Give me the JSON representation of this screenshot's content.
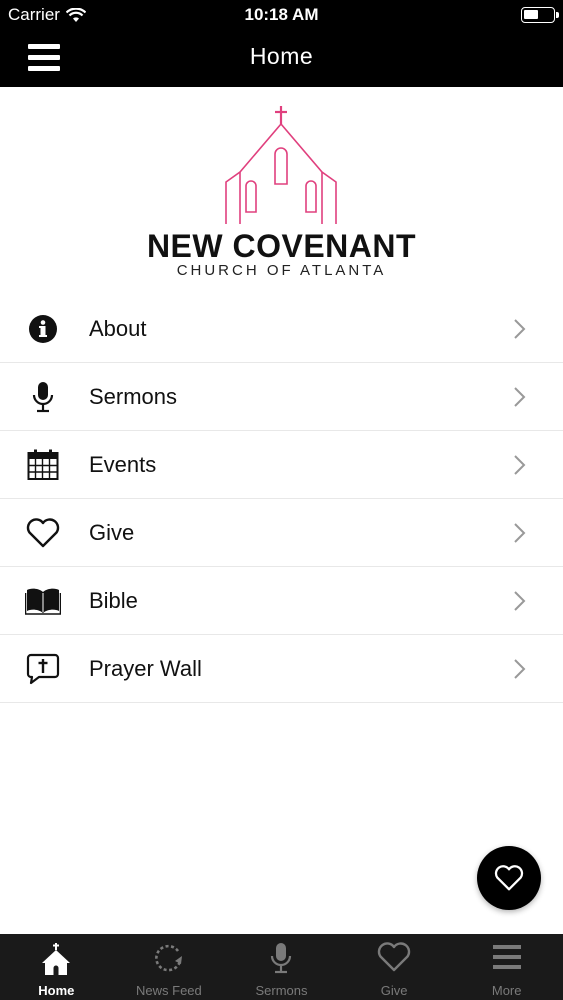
{
  "status_bar": {
    "carrier": "Carrier",
    "time": "10:18 AM"
  },
  "nav": {
    "title": "Home"
  },
  "logo": {
    "name": "NEW COVENANT",
    "subtitle": "CHURCH OF ATLANTA",
    "accent_color": "#e0407e"
  },
  "menu": {
    "items": [
      {
        "label": "About",
        "icon": "info-icon"
      },
      {
        "label": "Sermons",
        "icon": "microphone-icon"
      },
      {
        "label": "Events",
        "icon": "calendar-icon"
      },
      {
        "label": "Give",
        "icon": "heart-icon"
      },
      {
        "label": "Bible",
        "icon": "book-icon"
      },
      {
        "label": "Prayer Wall",
        "icon": "prayer-bubble-icon"
      }
    ]
  },
  "fab": {
    "icon": "heart-icon"
  },
  "tabbar": {
    "tabs": [
      {
        "label": "Home",
        "icon": "church-icon",
        "active": true
      },
      {
        "label": "News Feed",
        "icon": "refresh-icon",
        "active": false
      },
      {
        "label": "Sermons",
        "icon": "microphone-icon",
        "active": false
      },
      {
        "label": "Give",
        "icon": "heart-icon",
        "active": false
      },
      {
        "label": "More",
        "icon": "menu-icon",
        "active": false
      }
    ]
  },
  "colors": {
    "bar_background": "#000000",
    "tabbar_background": "#1a1a1a",
    "tab_inactive": "#7a7a7a",
    "tab_active": "#ffffff"
  }
}
